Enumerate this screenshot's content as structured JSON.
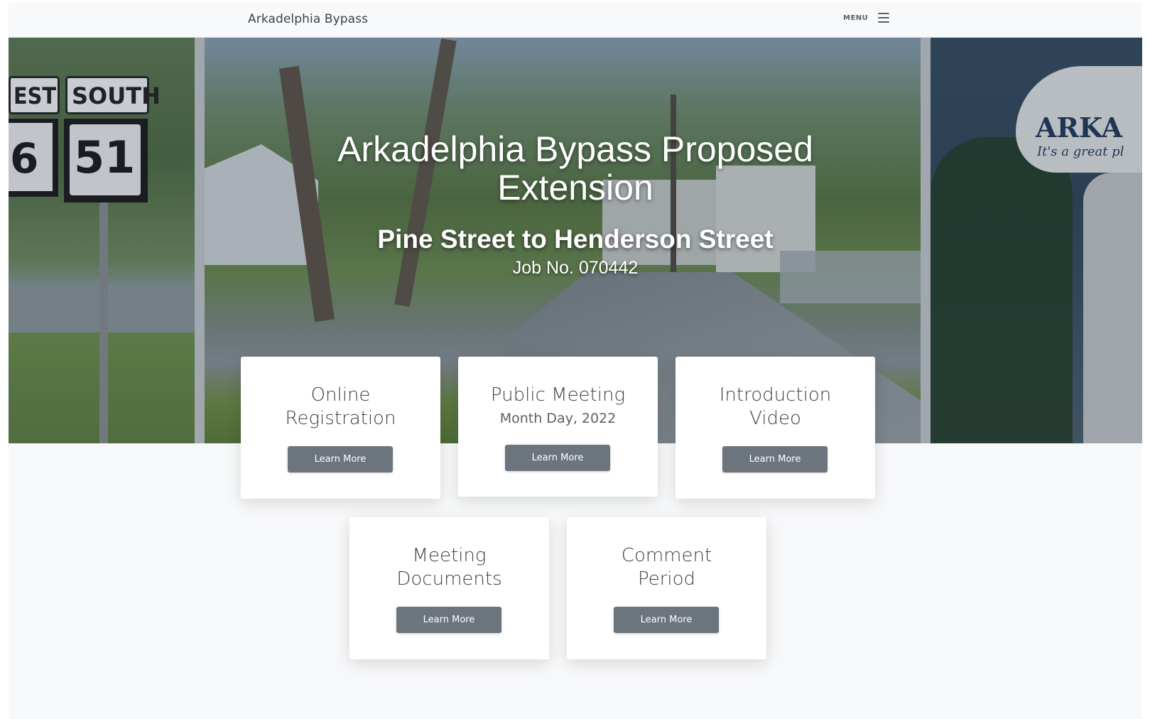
{
  "navbar": {
    "brand": "Arkadelphia Bypass",
    "menu_label": "MENU",
    "menu_icon": "hamburger-icon"
  },
  "hero": {
    "title_line1": "Arkadelphia Bypass Proposed",
    "title_line2": "Extension",
    "subtitle": "Pine Street to Henderson Street",
    "job": "Job No. 070442",
    "photo_text": {
      "sign_top_left": "EST",
      "sign_top_right": "SOUTH",
      "shield_left": "6",
      "shield_right": "51",
      "tower_name": "ARKA",
      "tower_tagline": "It's a great pl"
    }
  },
  "cards": [
    {
      "title_line1": "Online",
      "title_line2": "Registration",
      "subtitle": "",
      "button": "Learn More"
    },
    {
      "title_line1": "Public Meeting",
      "title_line2": "",
      "subtitle": "Month Day, 2022",
      "button": "Learn More"
    },
    {
      "title_line1": "Introduction",
      "title_line2": "Video",
      "subtitle": "",
      "button": "Learn More"
    },
    {
      "title_line1": "Meeting",
      "title_line2": "Documents",
      "subtitle": "",
      "button": "Learn More"
    },
    {
      "title_line1": "Comment",
      "title_line2": "Period",
      "subtitle": "",
      "button": "Learn More"
    }
  ],
  "colors": {
    "button_bg": "#6c757d",
    "navbar_bg": "#f8f9fa",
    "page_bg": "#f7f8f9"
  }
}
